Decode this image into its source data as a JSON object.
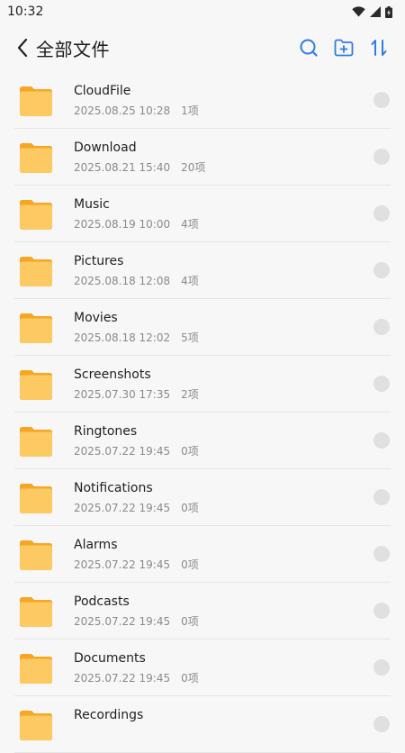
{
  "status_bar": {
    "time": "10:32"
  },
  "header": {
    "title": "全部文件"
  },
  "files": [
    {
      "name": "CloudFile",
      "date": "2025.08.25 10:28",
      "count": "1项"
    },
    {
      "name": "Download",
      "date": "2025.08.21 15:40",
      "count": "20项"
    },
    {
      "name": "Music",
      "date": "2025.08.19 10:00",
      "count": "4项"
    },
    {
      "name": "Pictures",
      "date": "2025.08.18 12:08",
      "count": "4项"
    },
    {
      "name": "Movies",
      "date": "2025.08.18 12:02",
      "count": "5项"
    },
    {
      "name": "Screenshots",
      "date": "2025.07.30 17:35",
      "count": "2项"
    },
    {
      "name": "Ringtones",
      "date": "2025.07.22 19:45",
      "count": "0项"
    },
    {
      "name": "Notifications",
      "date": "2025.07.22 19:45",
      "count": "0项"
    },
    {
      "name": "Alarms",
      "date": "2025.07.22 19:45",
      "count": "0项"
    },
    {
      "name": "Podcasts",
      "date": "2025.07.22 19:45",
      "count": "0项"
    },
    {
      "name": "Documents",
      "date": "2025.07.22 19:45",
      "count": "0项"
    },
    {
      "name": "Recordings",
      "date": "",
      "count": ""
    }
  ],
  "colors": {
    "accent": "#2f7de1",
    "folder": "#fbc65a"
  },
  "icons": {
    "back": "chevron-left-icon",
    "search": "search-icon",
    "new_folder": "new-folder-icon",
    "sort": "sort-icon"
  }
}
